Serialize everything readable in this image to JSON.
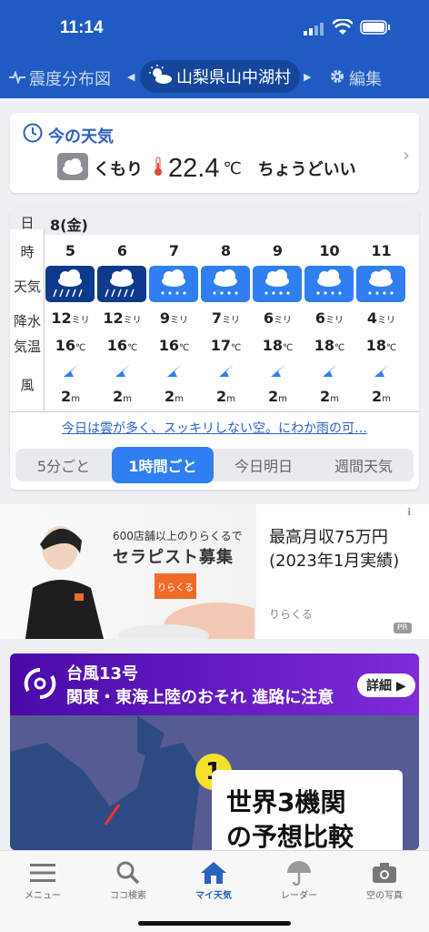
{
  "status": {
    "time": "11:14"
  },
  "topbar": {
    "left_label": "震度分布図",
    "location": "山梨県山中湖村",
    "right_label": "編集"
  },
  "now": {
    "title": "今の天気",
    "condition": "くもり",
    "temperature": "22.4",
    "unit": "℃",
    "feel": "ちょうどいい"
  },
  "hourly": {
    "day": "8(金)",
    "row_labels": [
      "日",
      "時",
      "天気",
      "降水",
      "気温",
      "風"
    ],
    "hours": [
      {
        "hour": "5",
        "weather": "heavy-rain",
        "rain": "12",
        "temp": "16",
        "wind": "2"
      },
      {
        "hour": "6",
        "weather": "heavy-rain",
        "rain": "12",
        "temp": "16",
        "wind": "2"
      },
      {
        "hour": "7",
        "weather": "rain",
        "rain": "9",
        "temp": "16",
        "wind": "2"
      },
      {
        "hour": "8",
        "weather": "rain",
        "rain": "7",
        "temp": "17",
        "wind": "2"
      },
      {
        "hour": "9",
        "weather": "rain",
        "rain": "6",
        "temp": "18",
        "wind": "2"
      },
      {
        "hour": "10",
        "weather": "rain",
        "rain": "6",
        "temp": "18",
        "wind": "2"
      },
      {
        "hour": "11",
        "weather": "rain",
        "rain": "4",
        "temp": "18",
        "wind": "2"
      }
    ],
    "units": {
      "rain": "ミリ",
      "temp": "℃",
      "wind": "m"
    },
    "summary": "今日は雲が多く、スッキリしない空。にわか雨の可…",
    "tabs": [
      "5分ごと",
      "1時間ごと",
      "今日明日",
      "週間天気"
    ],
    "active_tab": "1時間ごと"
  },
  "ad": {
    "line1": "600店舗以上のりらくるで",
    "line2": "セラピスト募集",
    "logo": "りらくる",
    "text1": "最高月収75万円",
    "text2": "(2023年1月実績)",
    "brand": "りらくる",
    "pr": "PR"
  },
  "typhoon": {
    "title": "台風13号",
    "subtitle": "関東・東海上陸のおそれ 進路に注意",
    "more": "詳細",
    "number": "1",
    "box_line1": "世界3機関",
    "box_line2": "の予想比較"
  },
  "tabbar": [
    "メニュー",
    "ココ検索",
    "マイ天気",
    "レーダー",
    "空の写真"
  ],
  "colors": {
    "primary": "#1f5bc2",
    "heavy_rain": "#0d3a8c",
    "rain": "#2f7ff0",
    "accent_text": "#2b62c0"
  }
}
